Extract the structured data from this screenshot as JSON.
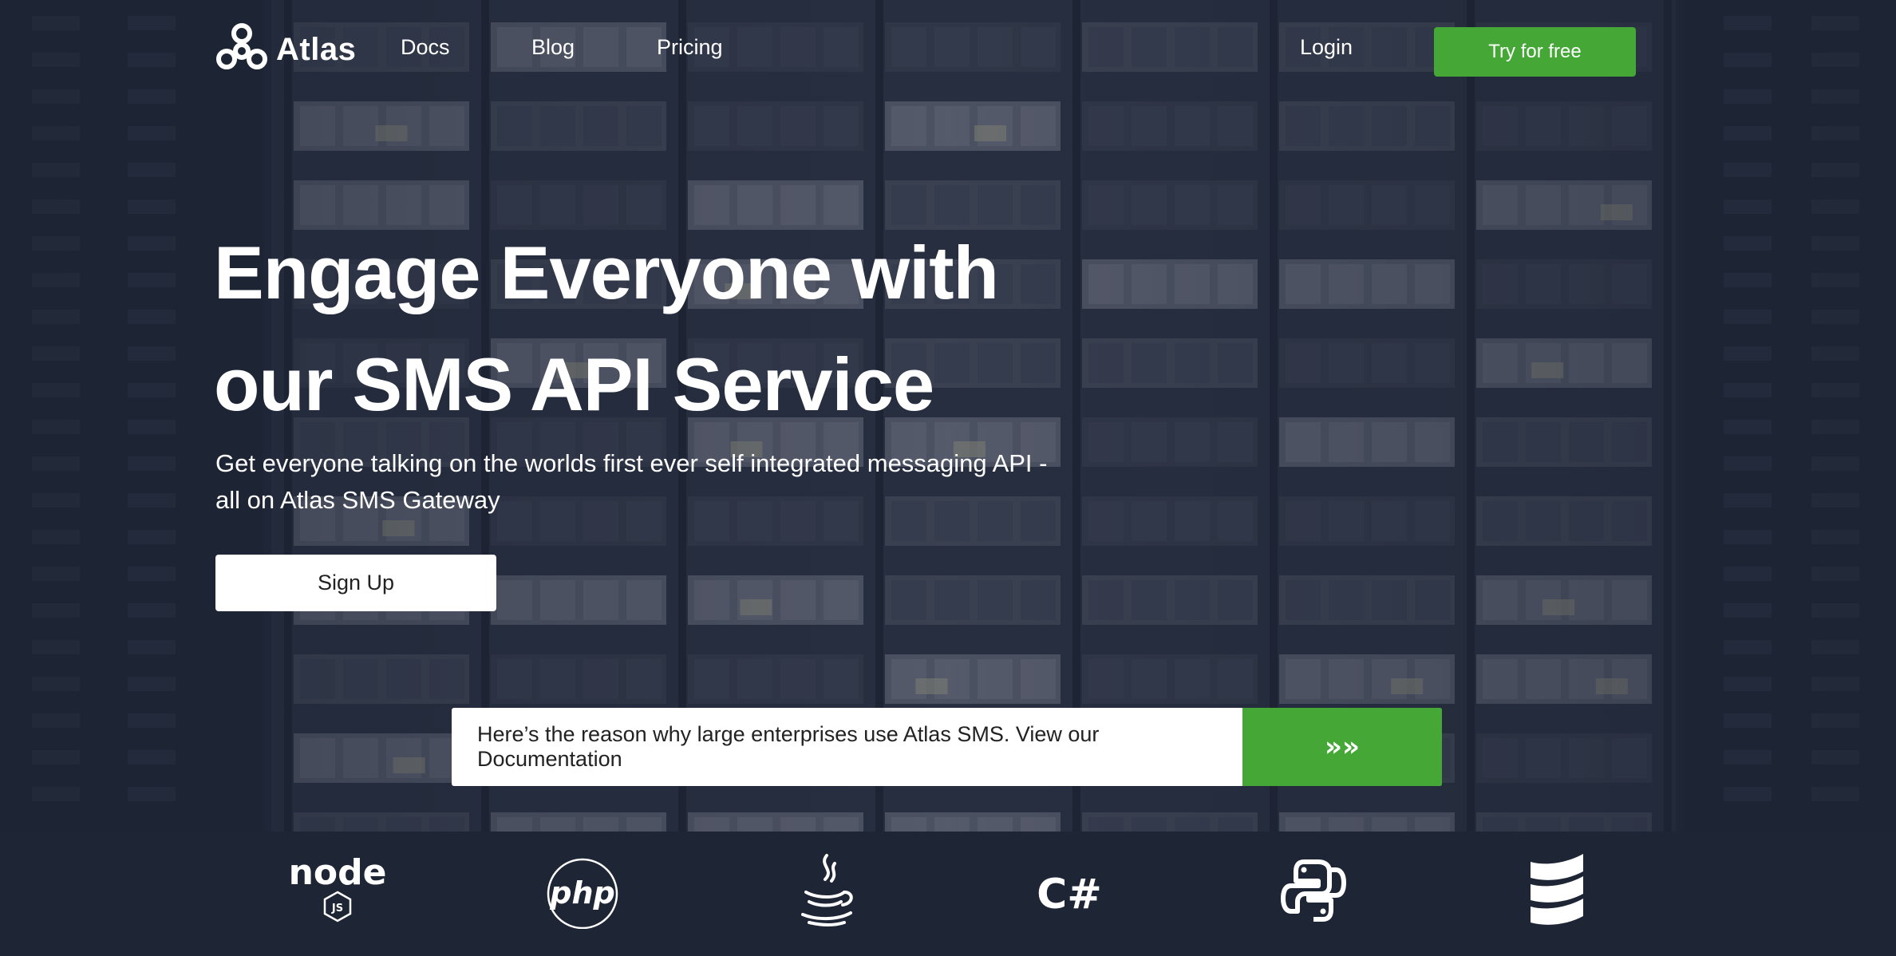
{
  "nav": {
    "brand": "Atlas",
    "links": [
      "Docs",
      "Blog",
      "Pricing"
    ],
    "login": "Login",
    "cta": "Try for free"
  },
  "hero": {
    "title_lines": [
      "Engage Everyone with",
      "our SMS API Service"
    ],
    "subtitle_lines": [
      "Get everyone talking on the worlds first ever self integrated messaging API -",
      "all on Atlas SMS Gateway"
    ],
    "signup": "Sign Up"
  },
  "banner": {
    "text": "Here’s the reason why large enterprises use Atlas SMS. View our Documentation",
    "arrow": "»»"
  },
  "languages": [
    "node-js-icon",
    "php-icon",
    "java-icon",
    "csharp-icon",
    "python-icon",
    "scala-icon"
  ],
  "language_text": {
    "node": "node",
    "js": "JS",
    "php": "php",
    "csharp": "C#"
  },
  "colors": {
    "accent_green": "#44a736",
    "background_navy": "#1e2535",
    "text_white": "#ffffff"
  }
}
